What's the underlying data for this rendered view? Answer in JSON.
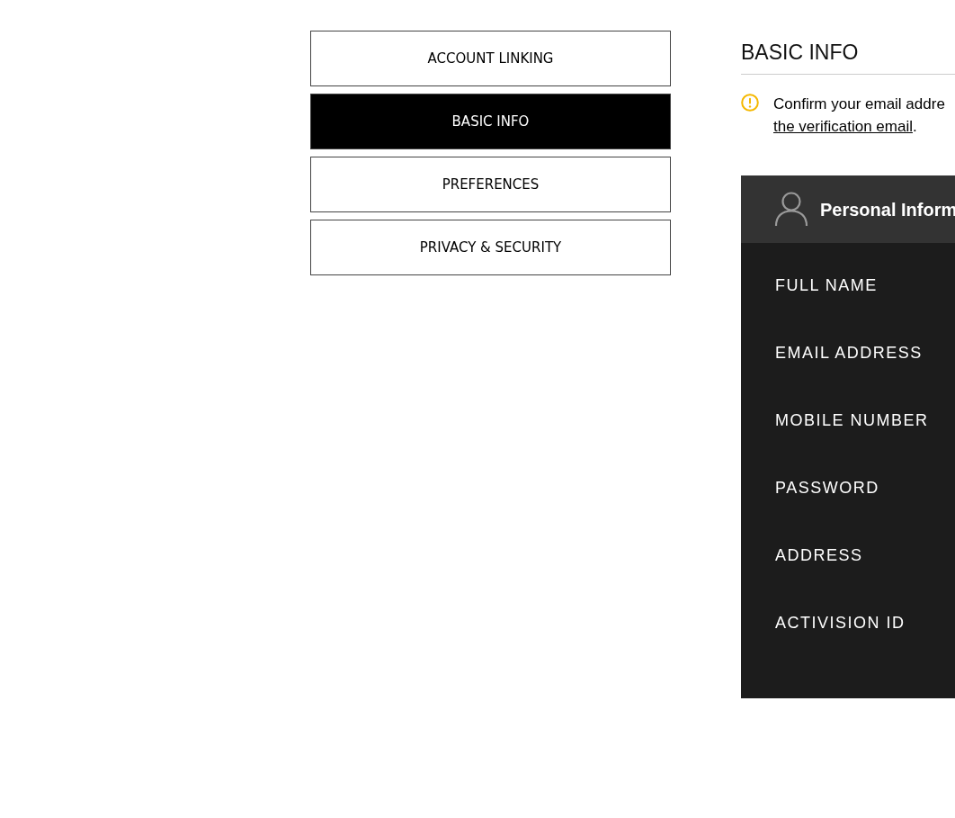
{
  "nav": [
    {
      "label": "ACCOUNT LINKING",
      "selected": false
    },
    {
      "label": "BASIC INFO",
      "selected": true
    },
    {
      "label": "PREFERENCES",
      "selected": false
    },
    {
      "label": "PRIVACY & SECURITY",
      "selected": false
    }
  ],
  "section": {
    "title": "BASIC INFO",
    "notice": {
      "text": "Confirm your email addre",
      "link": "the verification email",
      "suffix": "."
    }
  },
  "card": {
    "title": "Personal Inform",
    "fields": [
      "FULL NAME",
      "EMAIL ADDRESS",
      "MOBILE NUMBER",
      "PASSWORD",
      "ADDRESS",
      "ACTIVISION ID"
    ]
  }
}
